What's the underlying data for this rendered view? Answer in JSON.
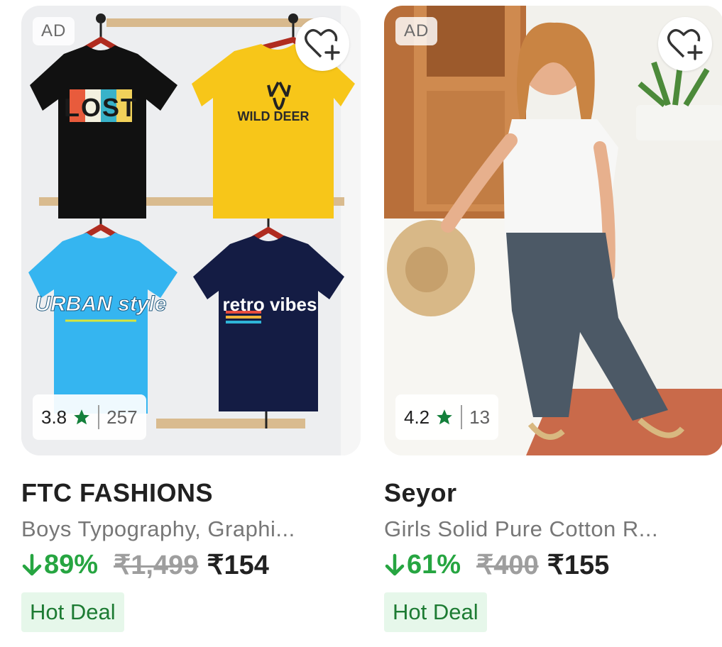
{
  "products": [
    {
      "ad_label": "AD",
      "wishlist_icon": "heart-plus-icon",
      "rating": "3.8",
      "rating_count": "257",
      "brand": "FTC FASHIONS",
      "title": "Boys Typography, Graphi...",
      "discount": "89%",
      "mrp": "₹1,499",
      "price": "₹154",
      "deal_label": "Hot Deal",
      "shirt_texts": [
        "LOST",
        "WILD DEER",
        "URBAN style",
        "retro vibes"
      ]
    },
    {
      "ad_label": "AD",
      "wishlist_icon": "heart-plus-icon",
      "rating": "4.2",
      "rating_count": "13",
      "brand": "Seyor",
      "title": "Girls Solid Pure Cotton R...",
      "discount": "61%",
      "mrp": "₹400",
      "price": "₹155",
      "deal_label": "Hot Deal"
    }
  ],
  "colors": {
    "discount_green": "#26a541",
    "star_green": "#14803b",
    "deal_bg": "#e6f7ea",
    "deal_text": "#1d7b33"
  }
}
